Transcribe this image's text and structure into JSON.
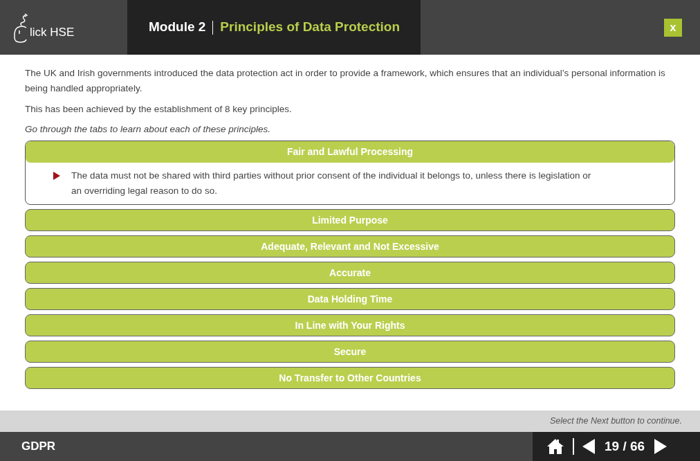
{
  "header": {
    "logo_text": "lick HSE",
    "module": "Module 2",
    "title": "Principles of Data Protection",
    "close": "x"
  },
  "intro": [
    "The UK and Irish governments introduced the data protection act in order to provide a framework, which ensures that an individual’s personal information is being handled appropriately.",
    "This has been achieved by the establishment of 8 key principles."
  ],
  "instruction": "Go through the tabs to learn about each of these principles.",
  "sections": [
    {
      "title": "Fair and Lawful Processing",
      "expanded": true,
      "points": [
        "The data must not be shared with third parties without prior consent of the individual it belongs to, unless there is legislation or an overriding legal reason to do so."
      ]
    },
    {
      "title": "Limited Purpose",
      "expanded": false
    },
    {
      "title": "Adequate, Relevant and Not Excessive",
      "expanded": false
    },
    {
      "title": "Accurate",
      "expanded": false
    },
    {
      "title": "Data Holding Time",
      "expanded": false
    },
    {
      "title": "In Line with Your Rights",
      "expanded": false
    },
    {
      "title": "Secure",
      "expanded": false
    },
    {
      "title": "No Transfer to Other Countries",
      "expanded": false
    }
  ],
  "hint": "Select the Next button to continue.",
  "footer": {
    "course": "GDPR",
    "page": "19 / 66"
  }
}
